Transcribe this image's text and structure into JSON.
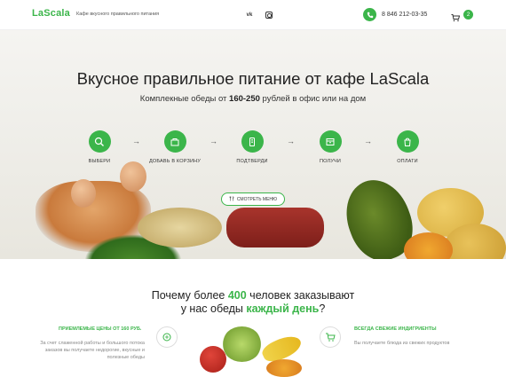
{
  "header": {
    "logo": "LaScala",
    "tagline": "Кафе вкусного правильного питания",
    "social": [
      {
        "icon": "vk-icon",
        "label": "vk"
      },
      {
        "icon": "instagram-icon",
        "label": ""
      }
    ],
    "phone": "8 846 212-03-35",
    "cart_count": "2"
  },
  "hero": {
    "title": "Вкусное правильное питание от кафе LaScala",
    "subtitle_prefix": "Комплекные обеды от ",
    "subtitle_price": "160-250",
    "subtitle_suffix": " рублей в офис или на дом",
    "steps": [
      {
        "label": "ВЫБЕРИ",
        "icon": "search-icon"
      },
      {
        "label": "ДОБАВЬ В КОРЗИНУ",
        "icon": "basket-icon"
      },
      {
        "label": "ПОДТВЕРДИ",
        "icon": "phone-icon"
      },
      {
        "label": "ПОЛУЧИ",
        "icon": "box-icon"
      },
      {
        "label": "ОПЛАТИ",
        "icon": "bag-icon"
      }
    ],
    "menu_button": "СМОТРЕТЬ МЕНЮ"
  },
  "why": {
    "line1_a": "Почему более ",
    "line1_num": "400",
    "line1_b": " человек заказывают",
    "line2_a": "у нас обеды ",
    "line2_hl": "каждый день",
    "line2_b": "?"
  },
  "features": [
    {
      "title": "ПРИЕМЛЕМЫЕ ЦЕНЫ ОТ 160 РУБ.",
      "text": "За счет слаженной работы и большого потока заказов вы получаете недорогие, вкусные и полезные обеды",
      "icon": "coins-icon"
    },
    {
      "title": "ВСЕГДА СВЕЖИЕ ИНДИГРИЕНТЫ",
      "text": "Вы получаете блюда из свежих продуктов",
      "icon": "cart-icon"
    }
  ],
  "colors": {
    "accent": "#3bb54a"
  }
}
